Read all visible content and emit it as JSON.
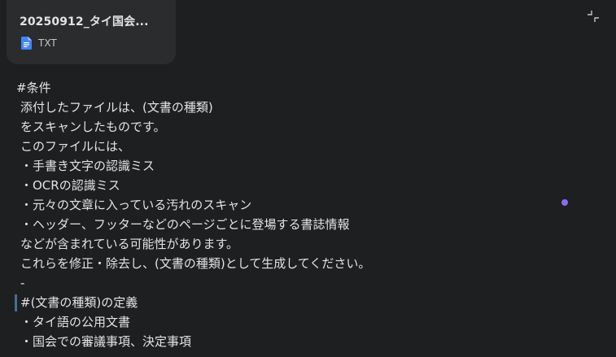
{
  "attachment": {
    "file_name": "20250912_タイ国会...",
    "file_type": "TXT",
    "icon": "google-docs-icon",
    "icon_color": "#4285f4"
  },
  "collapse_icon": "collapse-icon",
  "prompt": {
    "lines": [
      "#条件",
      "添付したファイルは、(文書の種類)",
      "をスキャンしたものです。",
      "このファイルには、",
      "・手書き文字の認識ミス",
      "・OCRの認識ミス",
      "・元々の文章に入っている汚れのスキャン",
      "・ヘッダー、フッターなどのページごとに登場する書誌情報",
      "などが含まれている可能性があります。",
      "これらを修正・除去し、(文書の種類)として生成してください。",
      "-",
      "#(文書の種類)の定義",
      "・タイ語の公用文書",
      "・国会での審議事項、決定事項"
    ]
  },
  "colors": {
    "background": "#1e1f20",
    "card": "#2b2c2e",
    "text": "#e3e3e3",
    "accent_dot": "#8b6cf0",
    "caret": "#4f6a8f"
  }
}
